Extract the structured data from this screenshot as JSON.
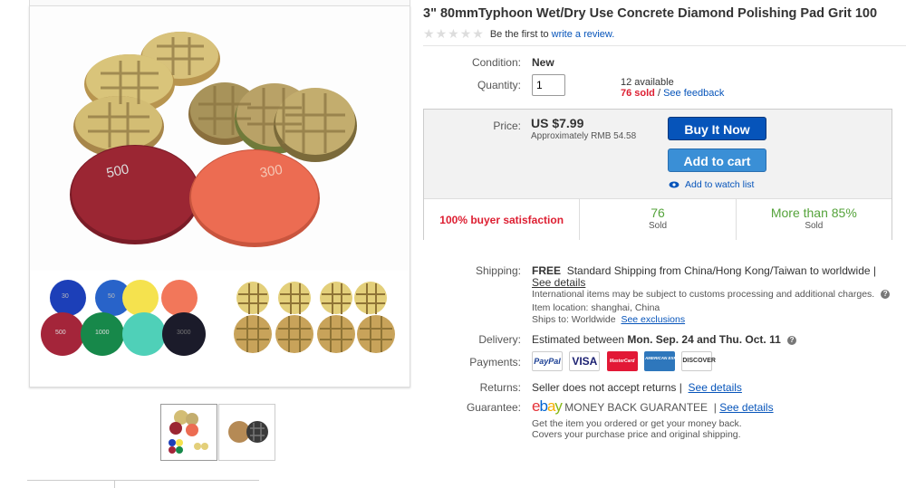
{
  "listing": {
    "title": "3\" 80mmTyphoon Wet/Dry Use Concrete Diamond Polishing Pad Grit 100",
    "rating_text": "Be the first to",
    "review_link": "write a review."
  },
  "images": {
    "main_pad_labels": [
      "500",
      "300"
    ],
    "bottom_left_pad_labels": [
      "30",
      "50",
      "500",
      "1000",
      "3000"
    ]
  },
  "details": {
    "condition_label": "Condition:",
    "condition_value": "New",
    "quantity_label": "Quantity:",
    "quantity_value": "1",
    "available": "12 available",
    "sold": "76 sold",
    "sold_separator": "/",
    "feedback_link": "See feedback"
  },
  "buybox": {
    "price_label": "Price:",
    "price": "US $7.99",
    "approx": "Approximately RMB 54.58",
    "buy_now": "Buy It Now",
    "add_to_cart": "Add to cart",
    "watch_list": "Add to watch list",
    "satisfaction": "100% buyer satisfaction",
    "stat1_value": "76",
    "stat1_label": "Sold",
    "stat2_value": "More than 85%",
    "stat2_label": "Sold"
  },
  "shipping": {
    "label": "Shipping:",
    "free": "FREE",
    "desc": "Standard Shipping from China/Hong Kong/Taiwan to worldwide |",
    "details_link": "See details",
    "intl_note": "International items may be subject to customs processing and additional charges.",
    "location": "Item location:  shanghai, China",
    "ships_to": "Ships to:  Worldwide",
    "exclusions_link": "See exclusions"
  },
  "delivery": {
    "label": "Delivery:",
    "prefix": "Estimated between",
    "dates": "Mon. Sep. 24 and Thu. Oct. 11"
  },
  "payments": {
    "label": "Payments:",
    "methods": [
      "PayPal",
      "VISA",
      "MasterCard",
      "AMERICAN EXPRESS",
      "DISCOVER"
    ]
  },
  "returns": {
    "label": "Returns:",
    "text": "Seller does not accept returns |",
    "details_link": "See details"
  },
  "guarantee": {
    "label": "Guarantee:",
    "brand": "ebay",
    "mbg": "MONEY BACK GUARANTEE",
    "details_link": "See details",
    "line1": "Get the item you ordered or get your money back.",
    "line2": "Covers your purchase price and original shipping."
  },
  "colors": {
    "link": "#0654ba",
    "buy_now": "#0654ba",
    "add_to_cart": "#3a8fd6",
    "sold_red": "#dd1e31",
    "stat_green": "#55a33b"
  }
}
